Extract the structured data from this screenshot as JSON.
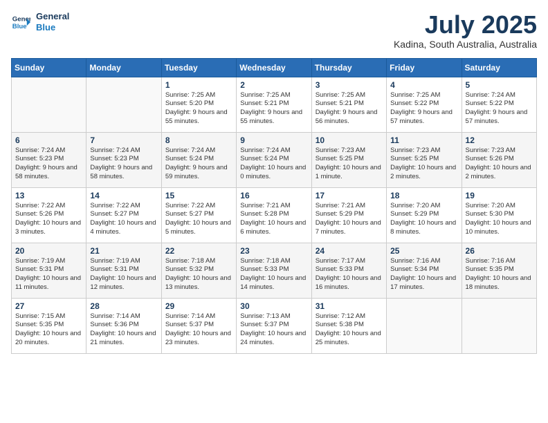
{
  "brand": {
    "name_general": "General",
    "name_blue": "Blue",
    "logo_icon": "▶"
  },
  "header": {
    "month_year": "July 2025",
    "location": "Kadina, South Australia, Australia"
  },
  "weekdays": [
    "Sunday",
    "Monday",
    "Tuesday",
    "Wednesday",
    "Thursday",
    "Friday",
    "Saturday"
  ],
  "weeks": [
    [
      {
        "day": "",
        "info": ""
      },
      {
        "day": "",
        "info": ""
      },
      {
        "day": "1",
        "info": "Sunrise: 7:25 AM\nSunset: 5:20 PM\nDaylight: 9 hours and 55 minutes."
      },
      {
        "day": "2",
        "info": "Sunrise: 7:25 AM\nSunset: 5:21 PM\nDaylight: 9 hours and 55 minutes."
      },
      {
        "day": "3",
        "info": "Sunrise: 7:25 AM\nSunset: 5:21 PM\nDaylight: 9 hours and 56 minutes."
      },
      {
        "day": "4",
        "info": "Sunrise: 7:25 AM\nSunset: 5:22 PM\nDaylight: 9 hours and 57 minutes."
      },
      {
        "day": "5",
        "info": "Sunrise: 7:24 AM\nSunset: 5:22 PM\nDaylight: 9 hours and 57 minutes."
      }
    ],
    [
      {
        "day": "6",
        "info": "Sunrise: 7:24 AM\nSunset: 5:23 PM\nDaylight: 9 hours and 58 minutes."
      },
      {
        "day": "7",
        "info": "Sunrise: 7:24 AM\nSunset: 5:23 PM\nDaylight: 9 hours and 58 minutes."
      },
      {
        "day": "8",
        "info": "Sunrise: 7:24 AM\nSunset: 5:24 PM\nDaylight: 9 hours and 59 minutes."
      },
      {
        "day": "9",
        "info": "Sunrise: 7:24 AM\nSunset: 5:24 PM\nDaylight: 10 hours and 0 minutes."
      },
      {
        "day": "10",
        "info": "Sunrise: 7:23 AM\nSunset: 5:25 PM\nDaylight: 10 hours and 1 minute."
      },
      {
        "day": "11",
        "info": "Sunrise: 7:23 AM\nSunset: 5:25 PM\nDaylight: 10 hours and 2 minutes."
      },
      {
        "day": "12",
        "info": "Sunrise: 7:23 AM\nSunset: 5:26 PM\nDaylight: 10 hours and 2 minutes."
      }
    ],
    [
      {
        "day": "13",
        "info": "Sunrise: 7:22 AM\nSunset: 5:26 PM\nDaylight: 10 hours and 3 minutes."
      },
      {
        "day": "14",
        "info": "Sunrise: 7:22 AM\nSunset: 5:27 PM\nDaylight: 10 hours and 4 minutes."
      },
      {
        "day": "15",
        "info": "Sunrise: 7:22 AM\nSunset: 5:27 PM\nDaylight: 10 hours and 5 minutes."
      },
      {
        "day": "16",
        "info": "Sunrise: 7:21 AM\nSunset: 5:28 PM\nDaylight: 10 hours and 6 minutes."
      },
      {
        "day": "17",
        "info": "Sunrise: 7:21 AM\nSunset: 5:29 PM\nDaylight: 10 hours and 7 minutes."
      },
      {
        "day": "18",
        "info": "Sunrise: 7:20 AM\nSunset: 5:29 PM\nDaylight: 10 hours and 8 minutes."
      },
      {
        "day": "19",
        "info": "Sunrise: 7:20 AM\nSunset: 5:30 PM\nDaylight: 10 hours and 10 minutes."
      }
    ],
    [
      {
        "day": "20",
        "info": "Sunrise: 7:19 AM\nSunset: 5:31 PM\nDaylight: 10 hours and 11 minutes."
      },
      {
        "day": "21",
        "info": "Sunrise: 7:19 AM\nSunset: 5:31 PM\nDaylight: 10 hours and 12 minutes."
      },
      {
        "day": "22",
        "info": "Sunrise: 7:18 AM\nSunset: 5:32 PM\nDaylight: 10 hours and 13 minutes."
      },
      {
        "day": "23",
        "info": "Sunrise: 7:18 AM\nSunset: 5:33 PM\nDaylight: 10 hours and 14 minutes."
      },
      {
        "day": "24",
        "info": "Sunrise: 7:17 AM\nSunset: 5:33 PM\nDaylight: 10 hours and 16 minutes."
      },
      {
        "day": "25",
        "info": "Sunrise: 7:16 AM\nSunset: 5:34 PM\nDaylight: 10 hours and 17 minutes."
      },
      {
        "day": "26",
        "info": "Sunrise: 7:16 AM\nSunset: 5:35 PM\nDaylight: 10 hours and 18 minutes."
      }
    ],
    [
      {
        "day": "27",
        "info": "Sunrise: 7:15 AM\nSunset: 5:35 PM\nDaylight: 10 hours and 20 minutes."
      },
      {
        "day": "28",
        "info": "Sunrise: 7:14 AM\nSunset: 5:36 PM\nDaylight: 10 hours and 21 minutes."
      },
      {
        "day": "29",
        "info": "Sunrise: 7:14 AM\nSunset: 5:37 PM\nDaylight: 10 hours and 23 minutes."
      },
      {
        "day": "30",
        "info": "Sunrise: 7:13 AM\nSunset: 5:37 PM\nDaylight: 10 hours and 24 minutes."
      },
      {
        "day": "31",
        "info": "Sunrise: 7:12 AM\nSunset: 5:38 PM\nDaylight: 10 hours and 25 minutes."
      },
      {
        "day": "",
        "info": ""
      },
      {
        "day": "",
        "info": ""
      }
    ]
  ]
}
